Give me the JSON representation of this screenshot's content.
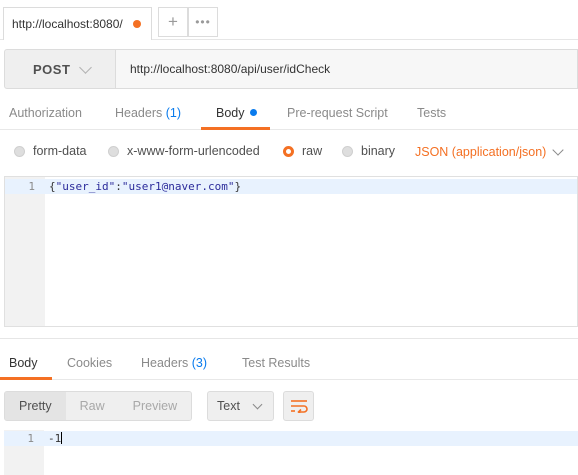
{
  "colors": {
    "accent": "#f47023",
    "link": "#097bed",
    "active_line": "#e8f2fe"
  },
  "tab": {
    "title": "http://localhost:8080/",
    "add_icon": "plus-icon",
    "more_icon": "more-horizontal-icon",
    "add_glyph": "+",
    "more_glyph": "•••"
  },
  "request": {
    "method": "POST",
    "url": "http://localhost:8080/api/user/idCheck",
    "tabs": [
      {
        "label": "Authorization"
      },
      {
        "label": "Headers",
        "count": "(1)"
      },
      {
        "label": "Body",
        "active": true
      },
      {
        "label": "Pre-request Script"
      },
      {
        "label": "Tests"
      }
    ],
    "body_types": [
      {
        "label": "form-data",
        "selected": false
      },
      {
        "label": "x-www-form-urlencoded",
        "selected": false
      },
      {
        "label": "raw",
        "selected": true
      },
      {
        "label": "binary",
        "selected": false
      }
    ],
    "content_type": "JSON (application/json)",
    "body": {
      "line_number": "1",
      "open": "{",
      "key": "\"user_id\"",
      "colon": ":",
      "value": "\"user1@naver.com\"",
      "close": "}"
    }
  },
  "response": {
    "tabs": [
      {
        "label": "Body",
        "active": true
      },
      {
        "label": "Cookies"
      },
      {
        "label": "Headers",
        "count": "(3)"
      },
      {
        "label": "Test Results"
      }
    ],
    "views": [
      "Pretty",
      "Raw",
      "Preview"
    ],
    "active_view": "Pretty",
    "format": "Text",
    "wrap_icon": "wrap-lines-icon",
    "body": {
      "line_number": "1",
      "text": "-1"
    }
  }
}
